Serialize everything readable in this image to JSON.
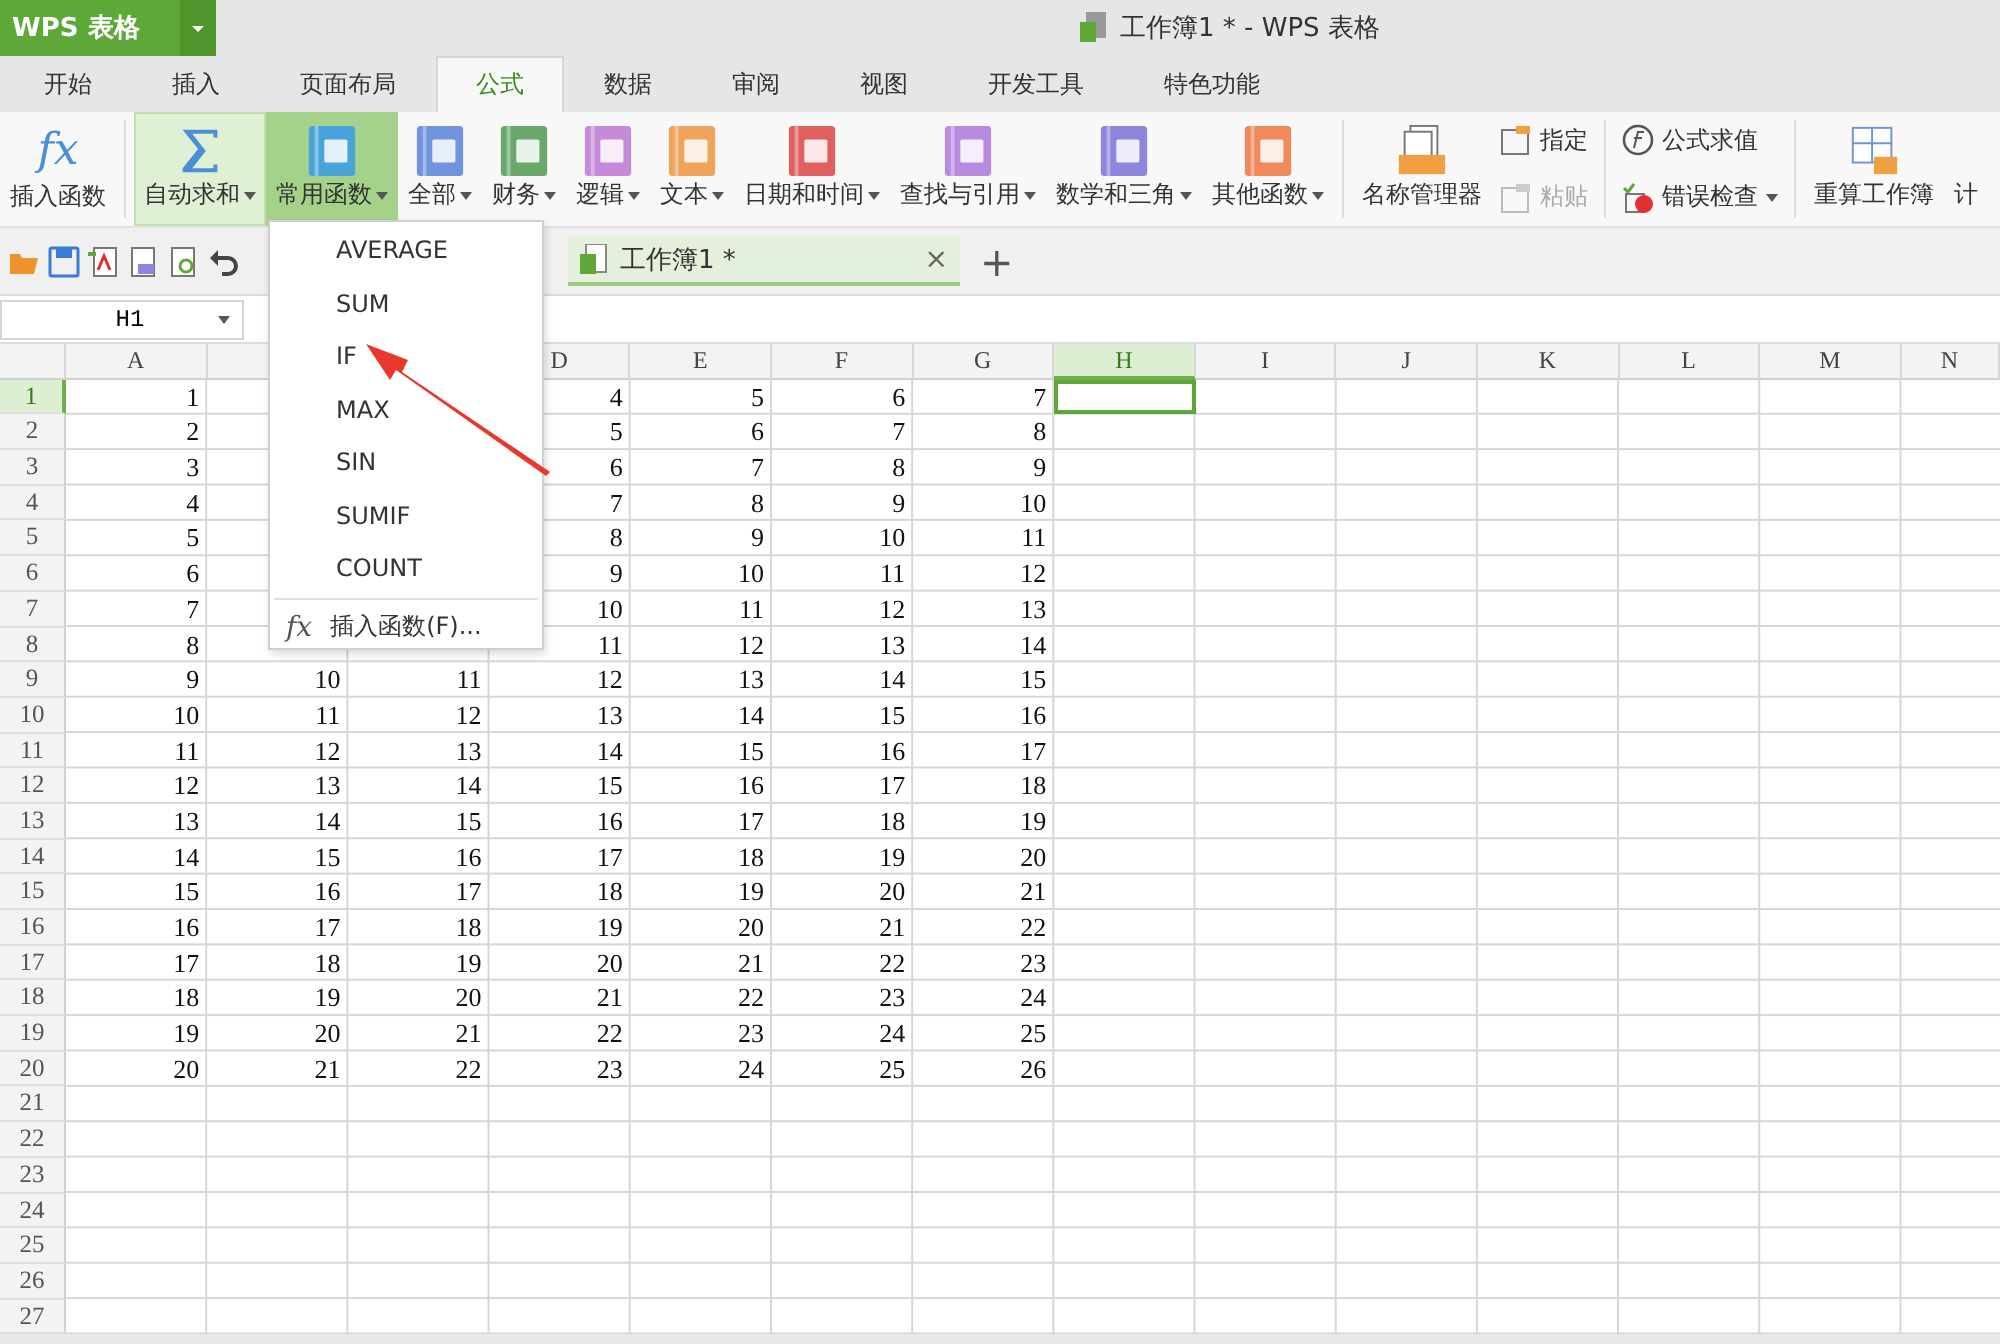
{
  "app_button": {
    "label": "WPS 表格"
  },
  "window": {
    "title": "工作簿1 * - WPS 表格"
  },
  "tabs": [
    {
      "label": "开始",
      "selected": false
    },
    {
      "label": "插入",
      "selected": false
    },
    {
      "label": "页面布局",
      "selected": false
    },
    {
      "label": "公式",
      "selected": true
    },
    {
      "label": "数据",
      "selected": false
    },
    {
      "label": "审阅",
      "selected": false
    },
    {
      "label": "视图",
      "selected": false
    },
    {
      "label": "开发工具",
      "selected": false
    },
    {
      "label": "特色功能",
      "selected": false
    }
  ],
  "ribbon": {
    "insert_function": {
      "icon_text": "fx",
      "label": "插入函数"
    },
    "functions": [
      {
        "label": "自动求和",
        "kind": "sigma",
        "hovered": true,
        "selected": false,
        "color": "#4a8fd8"
      },
      {
        "label": "常用函数",
        "kind": "book",
        "hovered": false,
        "selected": true,
        "color": "#4aa3d8"
      },
      {
        "label": "全部",
        "kind": "book",
        "hovered": false,
        "selected": false,
        "color": "#6f93dc"
      },
      {
        "label": "财务",
        "kind": "book",
        "hovered": false,
        "selected": false,
        "color": "#6aa86a"
      },
      {
        "label": "逻辑",
        "kind": "book",
        "hovered": false,
        "selected": false,
        "color": "#c58ad8"
      },
      {
        "label": "文本",
        "kind": "book",
        "hovered": false,
        "selected": false,
        "color": "#eea45a"
      },
      {
        "label": "日期和时间",
        "kind": "book",
        "hovered": false,
        "selected": false,
        "color": "#e06060"
      },
      {
        "label": "查找与引用",
        "kind": "book",
        "hovered": false,
        "selected": false,
        "color": "#b98ae0"
      },
      {
        "label": "数学和三角",
        "kind": "book",
        "hovered": false,
        "selected": false,
        "color": "#8c86dc"
      },
      {
        "label": "其他函数",
        "kind": "book",
        "hovered": false,
        "selected": false,
        "color": "#f08a5d"
      }
    ],
    "name_manager": {
      "label": "名称管理器"
    },
    "small": [
      {
        "label": "指定",
        "disabled": false
      },
      {
        "label": "粘贴",
        "disabled": true
      }
    ],
    "audit": [
      {
        "label": "公式求值",
        "dropdown": false
      },
      {
        "label": "错误检查",
        "dropdown": true
      }
    ],
    "recalc": {
      "label": "重算工作簿"
    },
    "cut_label": "计"
  },
  "document_tab": {
    "label": "工作簿1 *",
    "close": "×",
    "add": "+"
  },
  "name_box": {
    "value": "H1"
  },
  "columns": [
    {
      "label": "A",
      "selected": false
    },
    null,
    null,
    {
      "label": "D",
      "selected": false
    },
    {
      "label": "E",
      "selected": false
    },
    {
      "label": "F",
      "selected": false
    },
    {
      "label": "G",
      "selected": false
    },
    {
      "label": "H",
      "selected": true
    },
    {
      "label": "I",
      "selected": false
    },
    {
      "label": "J",
      "selected": false
    },
    {
      "label": "K",
      "selected": false
    },
    {
      "label": "L",
      "selected": false
    },
    {
      "label": "M",
      "selected": false
    },
    {
      "label": "N",
      "selected": false
    }
  ],
  "rows": [
    {
      "label": "1",
      "selected": true,
      "cells": [
        "1",
        null,
        null,
        "4",
        "5",
        "6",
        "7"
      ]
    },
    {
      "label": "2",
      "selected": false,
      "cells": [
        "2",
        null,
        null,
        "5",
        "6",
        "7",
        "8"
      ]
    },
    {
      "label": "3",
      "selected": false,
      "cells": [
        "3",
        null,
        null,
        "6",
        "7",
        "8",
        "9"
      ]
    },
    {
      "label": "4",
      "selected": false,
      "cells": [
        "4",
        null,
        null,
        "7",
        "8",
        "9",
        "10"
      ]
    },
    {
      "label": "5",
      "selected": false,
      "cells": [
        "5",
        null,
        null,
        "8",
        "9",
        "10",
        "11"
      ]
    },
    {
      "label": "6",
      "selected": false,
      "cells": [
        "6",
        null,
        null,
        "9",
        "10",
        "11",
        "12"
      ]
    },
    {
      "label": "7",
      "selected": false,
      "cells": [
        "7",
        null,
        null,
        "10",
        "11",
        "12",
        "13"
      ]
    },
    {
      "label": "8",
      "selected": false,
      "cells": [
        "8",
        null,
        null,
        "11",
        "12",
        "13",
        "14"
      ]
    },
    {
      "label": "9",
      "selected": false,
      "cells": [
        "9",
        "10",
        "11",
        "12",
        "13",
        "14",
        "15"
      ]
    },
    {
      "label": "10",
      "selected": false,
      "cells": [
        "10",
        "11",
        "12",
        "13",
        "14",
        "15",
        "16"
      ]
    },
    {
      "label": "11",
      "selected": false,
      "cells": [
        "11",
        "12",
        "13",
        "14",
        "15",
        "16",
        "17"
      ]
    },
    {
      "label": "12",
      "selected": false,
      "cells": [
        "12",
        "13",
        "14",
        "15",
        "16",
        "17",
        "18"
      ]
    },
    {
      "label": "13",
      "selected": false,
      "cells": [
        "13",
        "14",
        "15",
        "16",
        "17",
        "18",
        "19"
      ]
    },
    {
      "label": "14",
      "selected": false,
      "cells": [
        "14",
        "15",
        "16",
        "17",
        "18",
        "19",
        "20"
      ]
    },
    {
      "label": "15",
      "selected": false,
      "cells": [
        "15",
        "16",
        "17",
        "18",
        "19",
        "20",
        "21"
      ]
    },
    {
      "label": "16",
      "selected": false,
      "cells": [
        "16",
        "17",
        "18",
        "19",
        "20",
        "21",
        "22"
      ]
    },
    {
      "label": "17",
      "selected": false,
      "cells": [
        "17",
        "18",
        "19",
        "20",
        "21",
        "22",
        "23"
      ]
    },
    {
      "label": "18",
      "selected": false,
      "cells": [
        "18",
        "19",
        "20",
        "21",
        "22",
        "23",
        "24"
      ]
    },
    {
      "label": "19",
      "selected": false,
      "cells": [
        "19",
        "20",
        "21",
        "22",
        "23",
        "24",
        "25"
      ]
    },
    {
      "label": "20",
      "selected": false,
      "cells": [
        "20",
        "21",
        "22",
        "23",
        "24",
        "25",
        "26"
      ]
    },
    {
      "label": "21",
      "selected": false
    },
    {
      "label": "22",
      "selected": false
    },
    {
      "label": "23",
      "selected": false
    },
    {
      "label": "24",
      "selected": false
    },
    {
      "label": "25",
      "selected": false
    },
    {
      "label": "26",
      "selected": false
    },
    {
      "label": "27",
      "selected": false
    }
  ],
  "dropdown_menu": {
    "items": [
      "AVERAGE",
      "SUM",
      "IF",
      "MAX",
      "SIN",
      "SUMIF",
      "COUNT"
    ],
    "footer": {
      "icon_text": "fx",
      "label": "插入函数(F)..."
    }
  }
}
